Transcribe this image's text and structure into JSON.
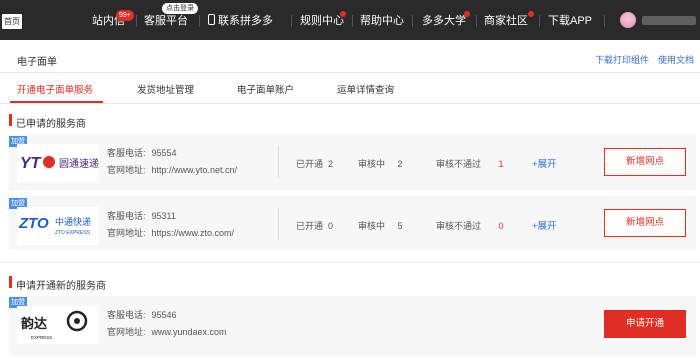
{
  "topbar": {
    "home": "首页",
    "items": {
      "inbox": "站内信",
      "inbox_count": "99+",
      "customer_service": "客服平台",
      "login_badge": "点击登录",
      "mobile": "联系拼多多",
      "rules": "规则中心",
      "help": "帮助中心",
      "university": "多多大学",
      "community": "商家社区",
      "download": "下载APP"
    }
  },
  "page": {
    "title": "电子面单",
    "link_download_print": "下载打印组件",
    "link_docs": "使用文档"
  },
  "tabs": [
    "开通电子面单服务",
    "发货地址管理",
    "电子面单账户",
    "运单详情查询"
  ],
  "applied_section": {
    "title": "已申请的服务商",
    "providers": [
      {
        "tag": "加盟",
        "logo_text": "圆通速递",
        "logo_mark": "YTO",
        "phone_label": "客服电话:",
        "phone": "95554",
        "site_label": "官网地址:",
        "site": "http://www.yto.net.cn/",
        "opened_label": "已开通",
        "opened": "2",
        "reviewing_label": "审核中",
        "reviewing": "2",
        "rejected_label": "审核不通过",
        "rejected": "1",
        "expand": "+展开",
        "action": "新增网点"
      },
      {
        "tag": "加盟",
        "logo_text": "中通快递",
        "logo_sub": "ZTO EXPRESS",
        "logo_mark": "ZTO",
        "phone_label": "客服电话:",
        "phone": "95311",
        "site_label": "官网地址:",
        "site": "https://www.zto.com/",
        "opened_label": "已开通",
        "opened": "0",
        "reviewing_label": "审核中",
        "reviewing": "5",
        "rejected_label": "审核不通过",
        "rejected": "0",
        "expand": "+展开",
        "action": "新增网点"
      }
    ]
  },
  "new_section": {
    "title": "申请开通新的服务商",
    "providers": [
      {
        "tag": "加盟",
        "logo_text": "韵达",
        "logo_sub": "EXPRESS",
        "phone_label": "客服电话:",
        "phone": "95546",
        "site_label": "官网地址:",
        "site": "www.yundaex.com",
        "action": "申请开通"
      }
    ]
  },
  "colors": {
    "accent": "#e02e24",
    "link": "#2f6fd8",
    "topbar": "#2a2a2a",
    "tag": "#4a90e2"
  }
}
